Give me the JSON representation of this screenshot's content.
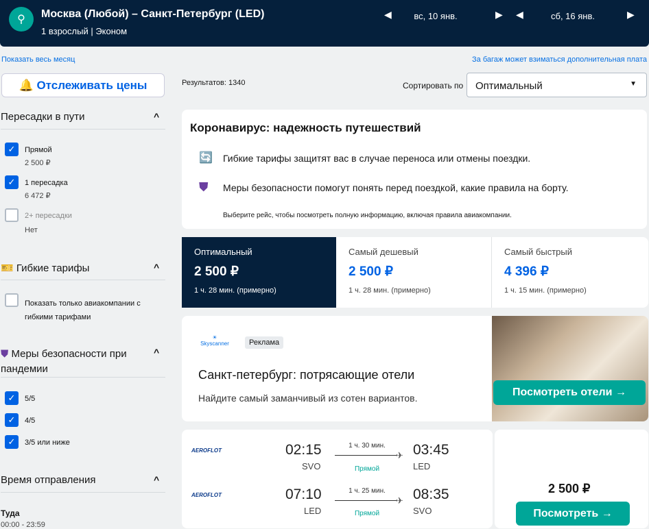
{
  "header": {
    "route": "Москва (Любой) – Санкт-Петербург (LED)",
    "passengers": "1 взрослый",
    "cabin": "Эконом",
    "depart_date": "вс, 10 янв.",
    "return_date": "сб, 16 янв."
  },
  "links": {
    "whole_month": "Показать весь месяц",
    "baggage": "За багаж может взиматься дополнительная плата"
  },
  "track_label": "Отслеживать цены",
  "results": "Результатов: 1340",
  "sort": {
    "label": "Сортировать по",
    "value": "Оптимальный"
  },
  "filters": {
    "stops": {
      "title": "Пересадки в пути",
      "opts": [
        {
          "label": "Прямой",
          "sub": "2 500 ₽"
        },
        {
          "label": "1 пересадка",
          "sub": "6 472 ₽"
        },
        {
          "label": "2+ пересадки",
          "sub": "Нет"
        }
      ]
    },
    "flex": {
      "title": "Гибкие тарифы",
      "opt": "Показать только авиакомпании с гибкими тарифами"
    },
    "safety": {
      "title": "Меры безопасности при пандемии",
      "opts": [
        "5/5",
        "4/5",
        "3/5 или ниже"
      ]
    },
    "time": {
      "title": "Время отправления",
      "leg": "Туда",
      "range": "00:00 - 23:59"
    }
  },
  "covid": {
    "title": "Коронавирус: надежность путешествий",
    "line1": "Гибкие тарифы защитят вас в случае переноса или отмены поездки.",
    "line2": "Меры безопасности помогут понять перед поездкой, какие правила на борту.",
    "note": "Выберите рейс, чтобы посмотреть полную информацию, включая правила авиакомпании."
  },
  "tabs": [
    {
      "name": "Оптимальный",
      "price": "2 500 ₽",
      "time": "1 ч. 28 мин. (примерно)"
    },
    {
      "name": "Самый дешевый",
      "price": "2 500 ₽",
      "time": "1 ч. 28 мин. (примерно)"
    },
    {
      "name": "Самый быстрый",
      "price": "4 396 ₽",
      "time": "1 ч. 15 мин. (примерно)"
    }
  ],
  "ad": {
    "brand": "Skyscanner",
    "badge": "Реклама",
    "title": "Санкт-петербург: потрясающие отели",
    "text": "Найдите самый заманчивый из сотен вариантов.",
    "button": "Посмотреть отели →"
  },
  "result": {
    "airline": "AEROFLOT",
    "price": "2 500 ₽",
    "button": "Посмотреть →",
    "legs": [
      {
        "dep": "02:15",
        "from": "SVO",
        "dur": "1 ч. 30 мин.",
        "type": "Прямой",
        "arr": "03:45",
        "to": "LED"
      },
      {
        "dep": "07:10",
        "from": "LED",
        "dur": "1 ч. 25 мин.",
        "type": "Прямой",
        "arr": "08:35",
        "to": "SVO"
      }
    ]
  }
}
